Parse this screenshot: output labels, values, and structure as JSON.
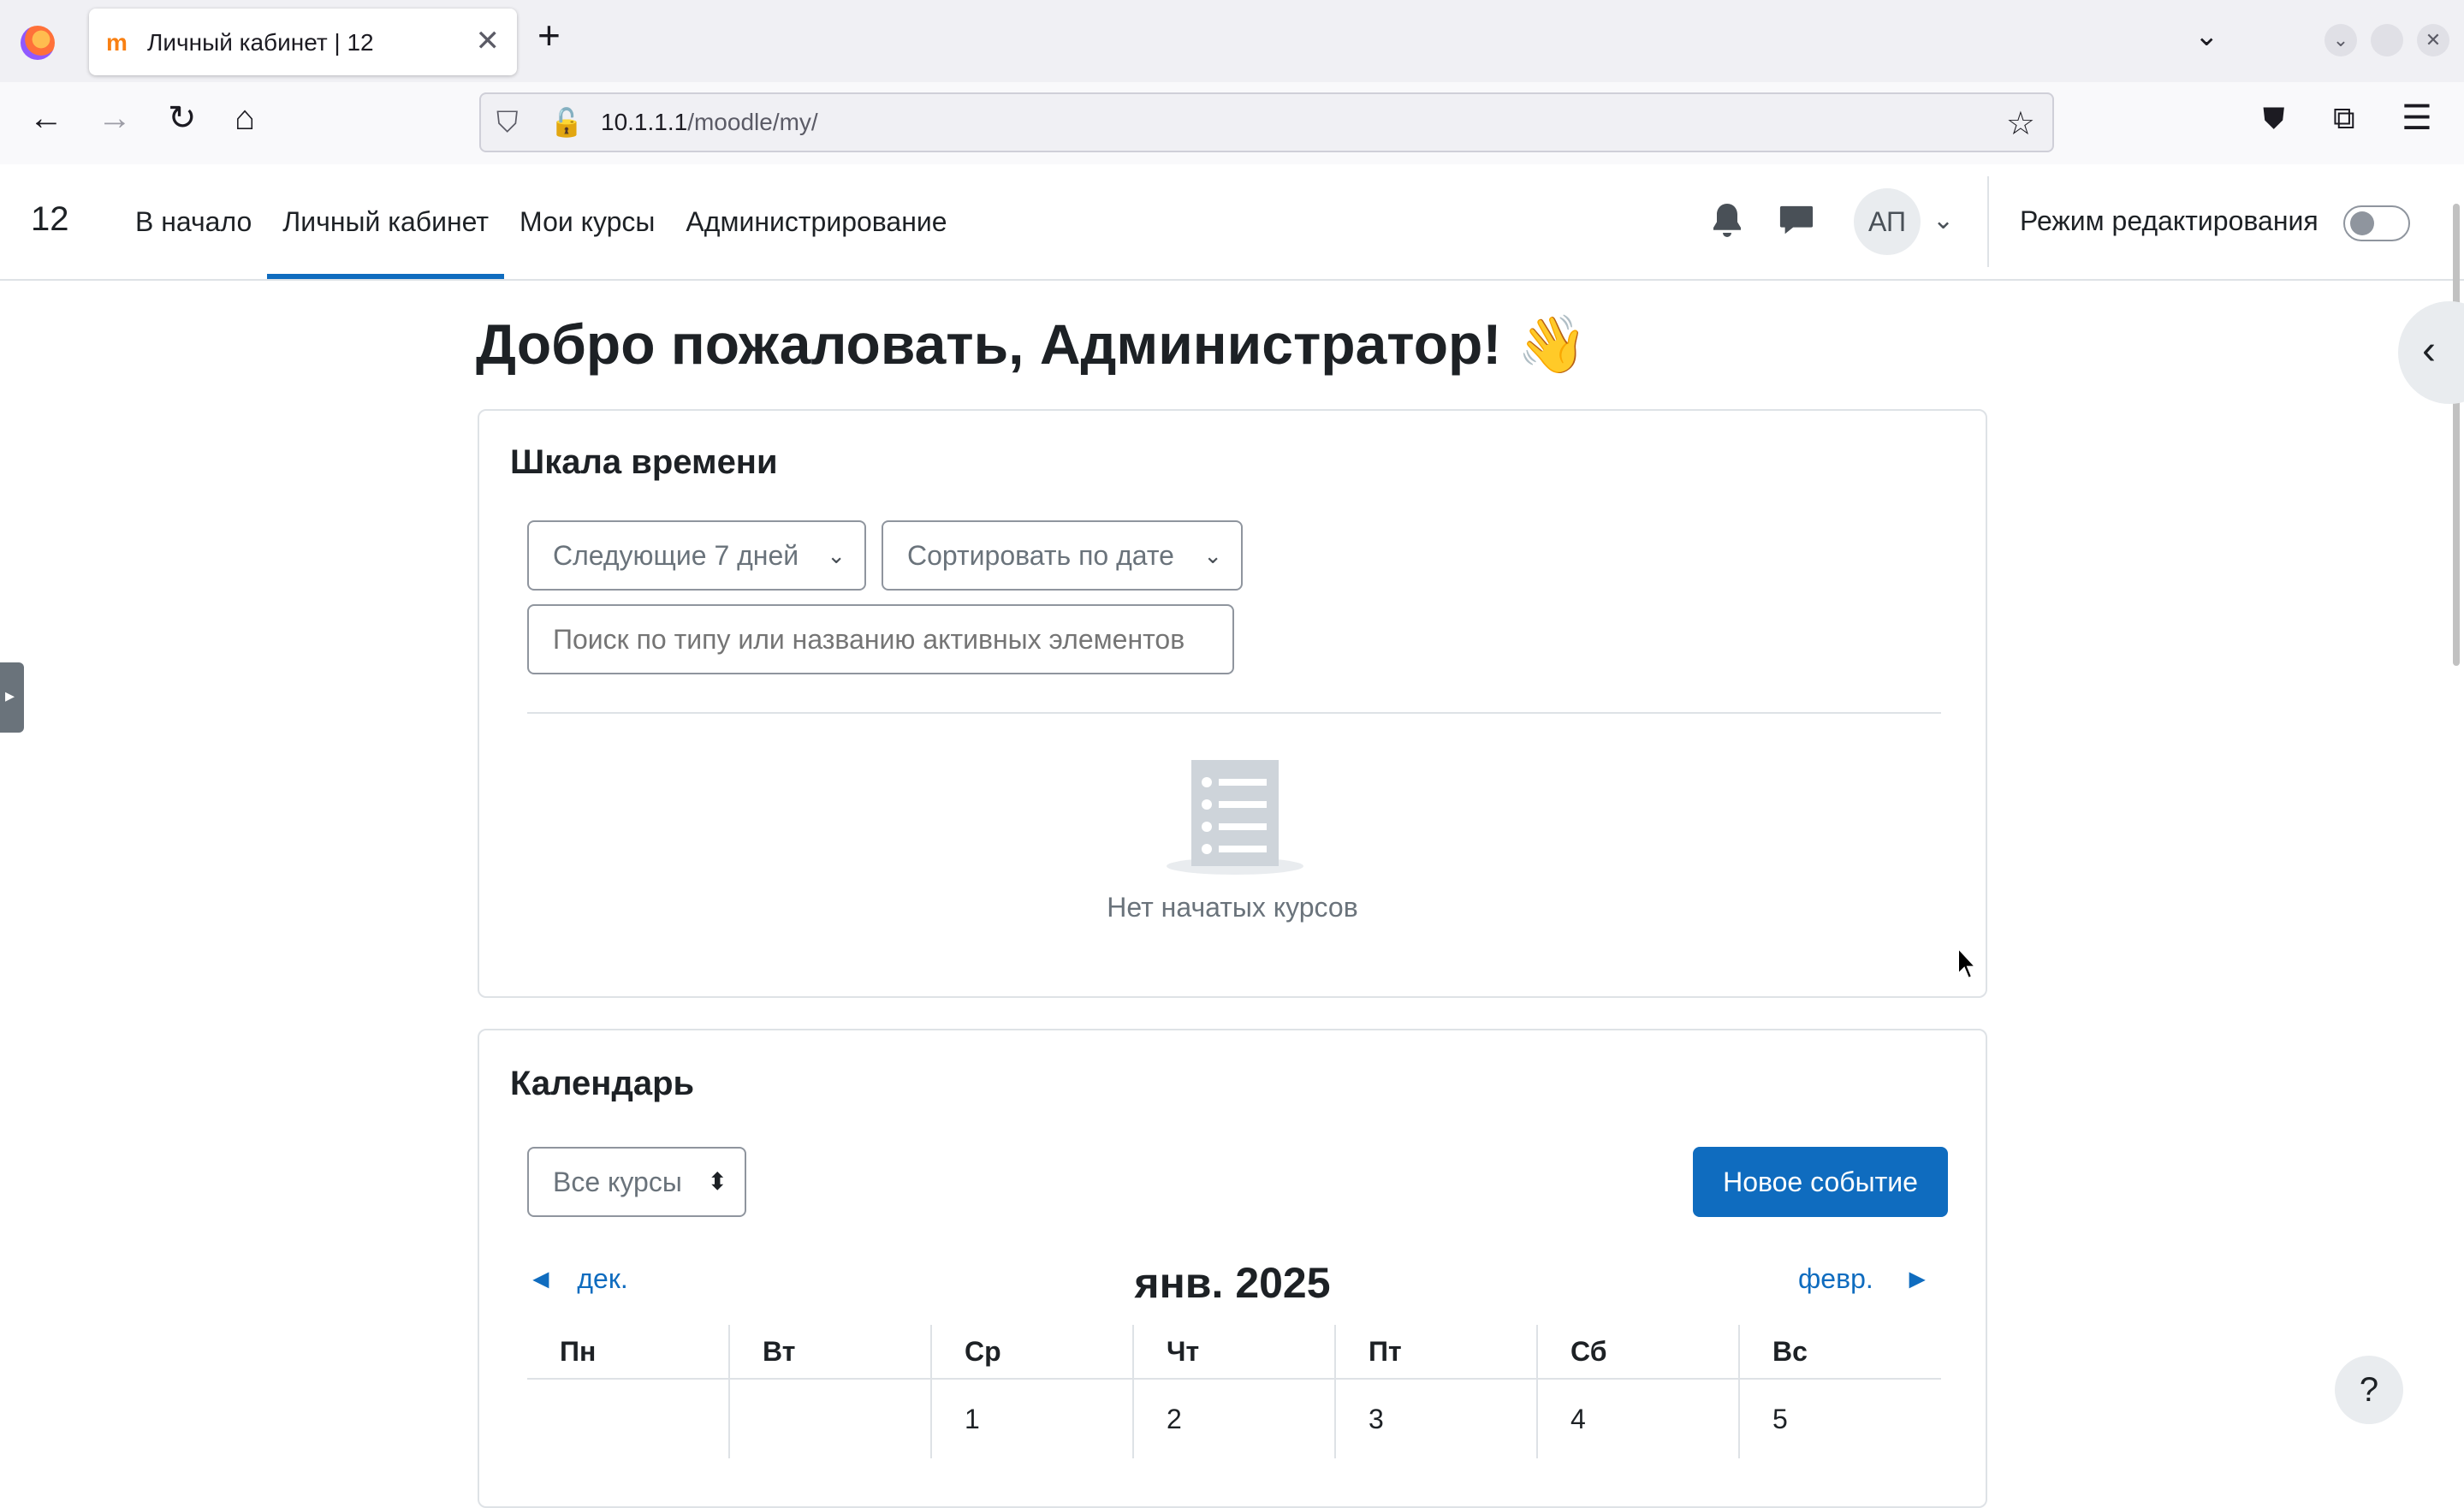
{
  "browser": {
    "tab_favicon": "m",
    "tab_title": "Личный кабинет | 12",
    "tab_close": "✕",
    "new_tab": "+",
    "url_host": "10.1.1.1",
    "url_path": "/moodle/my/"
  },
  "header": {
    "site_name": "12",
    "nav": [
      "В начало",
      "Личный кабинет",
      "Мои курсы",
      "Администрирование"
    ],
    "active_index": 1,
    "avatar_initials": "АП",
    "edit_mode_label": "Режим редактирования",
    "edit_mode_on": false
  },
  "page": {
    "welcome": "Добро пожаловать, Администратор! 👋"
  },
  "timeline": {
    "title": "Шкала времени",
    "filter_label": "Следующие 7 дней",
    "sort_label": "Сортировать по дате",
    "search_placeholder": "Поиск по типу или названию активных элементов",
    "empty_text": "Нет начатых курсов"
  },
  "calendar": {
    "title": "Календарь",
    "course_select": "Все курсы",
    "new_event": "Новое событие",
    "prev_month": "дек.",
    "month_title": "янв. 2025",
    "next_month": "февр.",
    "weekdays": [
      "Пн",
      "Вт",
      "Ср",
      "Чт",
      "Пт",
      "Сб",
      "Вс"
    ],
    "first_week": [
      "",
      "",
      "1",
      "2",
      "3",
      "4",
      "5"
    ]
  },
  "help_label": "?",
  "colors": {
    "primary": "#0f6cbf",
    "text": "#1d2125",
    "muted": "#6a737b",
    "border": "#dee2e6"
  }
}
